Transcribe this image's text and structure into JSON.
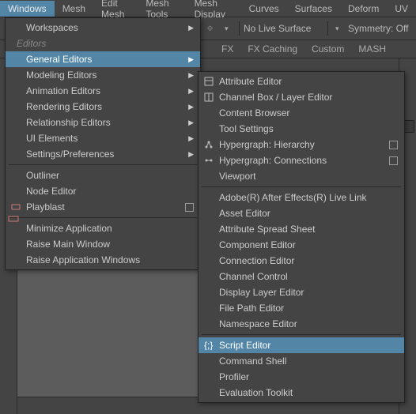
{
  "menubar": {
    "items": [
      "Windows",
      "Mesh",
      "Edit Mesh",
      "Mesh Tools",
      "Mesh Display",
      "Curves",
      "Surfaces",
      "Deform",
      "UV"
    ],
    "active_index": 0
  },
  "toolbar": {
    "live_surface": "No Live Surface",
    "symmetry": "Symmetry: Off"
  },
  "shelf": {
    "tabs": [
      "FX",
      "FX Caching",
      "Custom",
      "MASH"
    ]
  },
  "windows_menu": {
    "section_workspaces": "Workspaces",
    "section_editors": "Editors",
    "groups": [
      {
        "label": "General Editors",
        "highlight": true
      },
      {
        "label": "Modeling Editors"
      },
      {
        "label": "Animation Editors"
      },
      {
        "label": "Rendering Editors"
      },
      {
        "label": "Relationship Editors"
      },
      {
        "label": "UI Elements"
      },
      {
        "label": "Settings/Preferences"
      }
    ],
    "items_mid": [
      {
        "label": "Outliner"
      },
      {
        "label": "Node Editor"
      },
      {
        "label": "Playblast",
        "option": true,
        "left_icon": "playblast-icon"
      }
    ],
    "items_bottom": [
      {
        "label": "Minimize Application"
      },
      {
        "label": "Raise Main Window"
      },
      {
        "label": "Raise Application Windows"
      }
    ]
  },
  "general_menu": {
    "top": [
      {
        "label": "Attribute Editor",
        "icon": "attribute-editor-icon"
      },
      {
        "label": "Channel Box / Layer Editor",
        "icon": "channel-box-icon"
      },
      {
        "label": "Content Browser"
      },
      {
        "label": "Tool Settings"
      },
      {
        "label": "Hypergraph: Hierarchy",
        "icon": "hypergraph-hierarchy-icon",
        "option": true
      },
      {
        "label": "Hypergraph: Connections",
        "icon": "hypergraph-connections-icon",
        "option": true
      },
      {
        "label": "Viewport"
      }
    ],
    "mid": [
      {
        "label": "Adobe(R) After Effects(R) Live Link"
      },
      {
        "label": "Asset Editor"
      },
      {
        "label": "Attribute Spread Sheet"
      },
      {
        "label": "Component Editor"
      },
      {
        "label": "Connection Editor"
      },
      {
        "label": "Channel Control"
      },
      {
        "label": "Display Layer Editor"
      },
      {
        "label": "File Path Editor"
      },
      {
        "label": "Namespace Editor"
      }
    ],
    "bottom": [
      {
        "label": "Script Editor",
        "icon": "script-editor-icon",
        "highlight": true
      },
      {
        "label": "Command Shell"
      },
      {
        "label": "Profiler"
      },
      {
        "label": "Evaluation Toolkit"
      }
    ]
  },
  "colors": {
    "highlight": "#5285a6",
    "panel": "#444444",
    "text": "#cccccc"
  }
}
